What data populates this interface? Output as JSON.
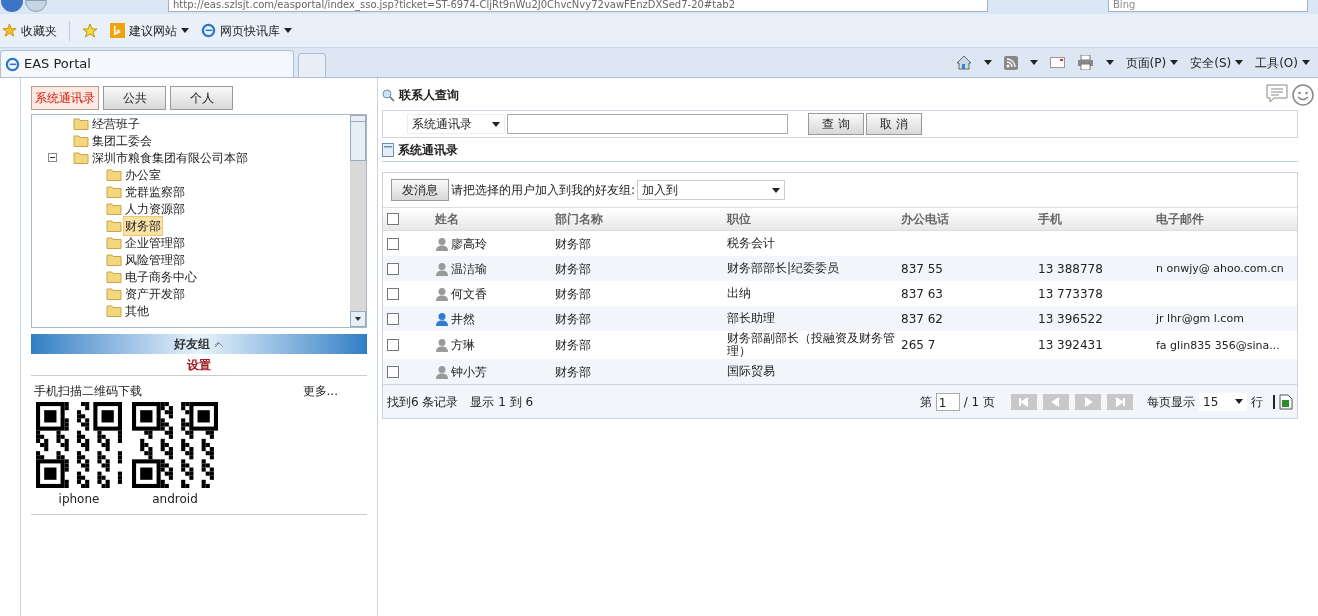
{
  "browser": {
    "url": "http://eas.szlsjt.com/easportal/index_sso.jsp?ticket=ST-6974-CljRt9nWu2J0ChvcNvy72vawFEnzDXSed7-20#tab2",
    "search_placeholder": "Bing",
    "favorites": [
      {
        "label": "收藏夹",
        "kind": "star"
      },
      {
        "label": "建议网站",
        "kind": "bing"
      },
      {
        "label": "网页快讯库",
        "kind": "ie"
      }
    ],
    "tab_title": "EAS Portal",
    "commands": [
      {
        "label": "页面(P)"
      },
      {
        "label": "安全(S)"
      },
      {
        "label": "工具(O)"
      }
    ]
  },
  "left": {
    "tabs": [
      {
        "label": "系统通讯录",
        "selected": true
      },
      {
        "label": "公共",
        "selected": false
      },
      {
        "label": "个人",
        "selected": false
      }
    ],
    "tree": [
      {
        "label": "经营班子",
        "selected": false
      },
      {
        "label": "集团工委会",
        "selected": false
      },
      {
        "label": "深圳市粮食集团有限公司本部",
        "selected": false,
        "expanded": true,
        "children": [
          {
            "label": "办公室",
            "selected": false
          },
          {
            "label": "党群监察部",
            "selected": false
          },
          {
            "label": "人力资源部",
            "selected": false
          },
          {
            "label": "财务部",
            "selected": true
          },
          {
            "label": "企业管理部",
            "selected": false
          },
          {
            "label": "风险管理部",
            "selected": false
          },
          {
            "label": "电子商务中心",
            "selected": false
          },
          {
            "label": "资产开发部",
            "selected": false
          },
          {
            "label": "其他",
            "selected": false
          }
        ]
      }
    ],
    "friends_header": "好友组",
    "settings": "设置",
    "qr": {
      "title": "手机扫描二维码下载",
      "more": "更多...",
      "codes": [
        {
          "label": "iphone"
        },
        {
          "label": "android"
        }
      ]
    }
  },
  "right": {
    "title": "联系人查询",
    "scope": "系统通讯录",
    "search_button": "查 询",
    "cancel_button": "取 消",
    "section_title": "系统通讯录",
    "send_button": "发消息",
    "add_label": "请把选择的用户加入到我的好友组:",
    "add_select": "加入到",
    "select_all_checked": false,
    "columns": [
      "姓名",
      "部门名称",
      "职位",
      "办公电话",
      "手机",
      "电子邮件"
    ],
    "rows": [
      {
        "name": "廖高玲",
        "dept": "财务部",
        "title": "税务会计",
        "office": "",
        "mobile": "",
        "email": "",
        "online": false,
        "checked": false
      },
      {
        "name": "温洁瑜",
        "dept": "财务部",
        "title": "财务部部长|纪委委员",
        "office": "837 55",
        "mobile": "13 388778",
        "email": "n onwjy@ ahoo.com.cn",
        "online": false,
        "checked": false
      },
      {
        "name": "何文香",
        "dept": "财务部",
        "title": "出纳",
        "office": "837 63",
        "mobile": "13 773378",
        "email": "",
        "online": false,
        "checked": false
      },
      {
        "name": "井然",
        "dept": "财务部",
        "title": "部长助理",
        "office": "837 62",
        "mobile": "13 396522",
        "email": "jr lhr@gm l.com",
        "online": true,
        "checked": false
      },
      {
        "name": "方琳",
        "dept": "财务部",
        "title": "财务部副部长（投融资及财务管理）",
        "office": "265 7",
        "mobile": "13 392431",
        "email": "fa glin835 356@sina...",
        "online": false,
        "checked": false
      },
      {
        "name": "钟小芳",
        "dept": "财务部",
        "title": "国际贸易",
        "office": "",
        "mobile": "",
        "email": "",
        "online": false,
        "checked": false
      }
    ],
    "footer": {
      "found": "找到6 条记录",
      "shown": "显示 1 到 6",
      "page_prefix": "第",
      "page": "1",
      "page_total": "/ 1 页",
      "per_page_label": "每页显示",
      "per_page": "15",
      "rows_unit": "行"
    }
  }
}
